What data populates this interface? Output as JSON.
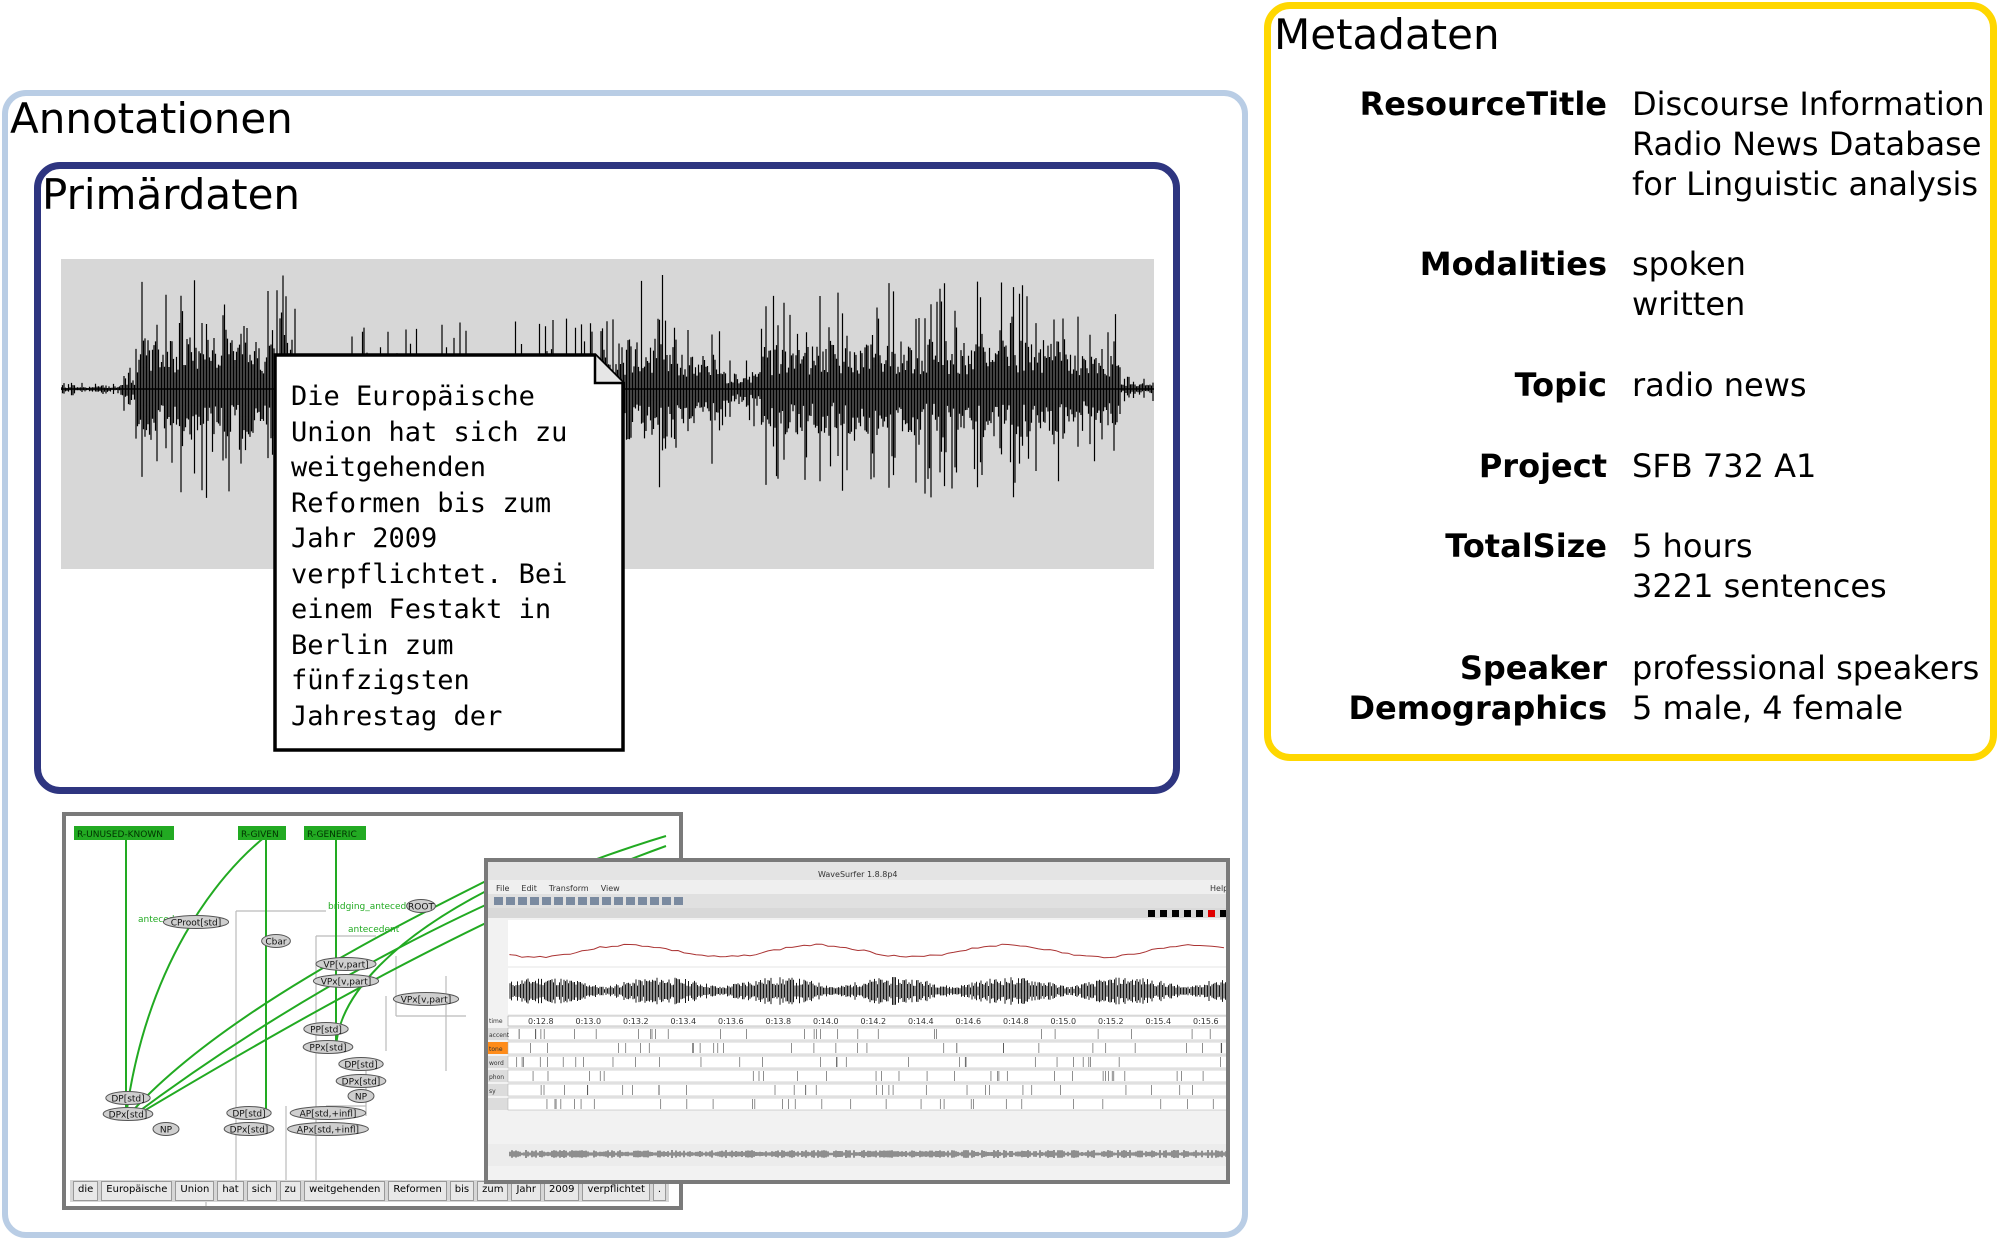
{
  "annotationen": {
    "title": "Annotationen"
  },
  "primaerdaten": {
    "title": "Primärdaten",
    "text_lines": [
      "Die Europäische",
      "Union hat sich zu",
      "weitgehenden",
      "Reformen bis zum",
      "Jahr 2009",
      "verpflichtet. Bei",
      "einem Festakt in",
      "Berlin zum",
      "fünfzigsten",
      "Jahrestag der"
    ]
  },
  "tree_screenshot": {
    "top_labels": [
      "R-UNUSED-KNOWN",
      "R-GIVEN",
      "R-GENERIC"
    ],
    "edge_labels": [
      "anteced",
      "bridging_antecedent",
      "antecedent"
    ],
    "nodes": [
      "CProot[std]",
      "ROOT",
      "Cbar",
      "VP[v,part]",
      "VPx[v,part]",
      "VPx[v,part]",
      "PP[std]",
      "PPx[std]",
      "DP[std]",
      "DPx[std]",
      "NP",
      "DP[std]",
      "DPx[std]",
      "NP",
      "DP[std]",
      "DPx[std]",
      "AP[std,+infl]",
      "APx[std,+infl]"
    ],
    "tokens": [
      "die",
      "Europäische",
      "Union",
      "hat",
      "sich",
      "zu",
      "weitgehenden",
      "Reformen",
      "bis",
      "zum",
      "Jahr",
      "2009",
      "verpflichtet",
      "."
    ]
  },
  "wavesurfer": {
    "title": "WaveSurfer 1.8.8p4",
    "menu": [
      "File",
      "Edit",
      "Transform",
      "View"
    ],
    "help": "Help",
    "time_ticks": [
      "0:12.8",
      "0:13.0",
      "0:13.2",
      "0:13.4",
      "0:13.6",
      "0:13.8",
      "0:14.0",
      "0:14.2",
      "0:14.4",
      "0:14.6",
      "0:14.8",
      "0:15.0",
      "0:15.2",
      "0:15.4",
      "0:15.6"
    ],
    "tier_labels": [
      "time",
      "accent",
      "tone",
      "word",
      "phon",
      "sy"
    ]
  },
  "metadaten": {
    "title": "Metadaten",
    "fields": [
      {
        "key": "ResourceTitle",
        "value": "Discourse Information\nRadio News Database\nfor Linguistic analysis"
      },
      {
        "key": "Modalities",
        "value": "spoken\nwritten"
      },
      {
        "key": "Topic",
        "value": "radio news"
      },
      {
        "key": "Project",
        "value": "SFB 732 A1"
      },
      {
        "key": "TotalSize",
        "value": "5 hours\n3221 sentences"
      },
      {
        "key": "Speaker\nDemographics",
        "value": "professional speakers\n5 male, 4 female"
      }
    ]
  },
  "colors": {
    "annotationen_border": "#b9cde5",
    "primaerdaten_border": "#2e3580",
    "metadaten_border": "#ffd700",
    "annotation_green": "#22aa22"
  }
}
